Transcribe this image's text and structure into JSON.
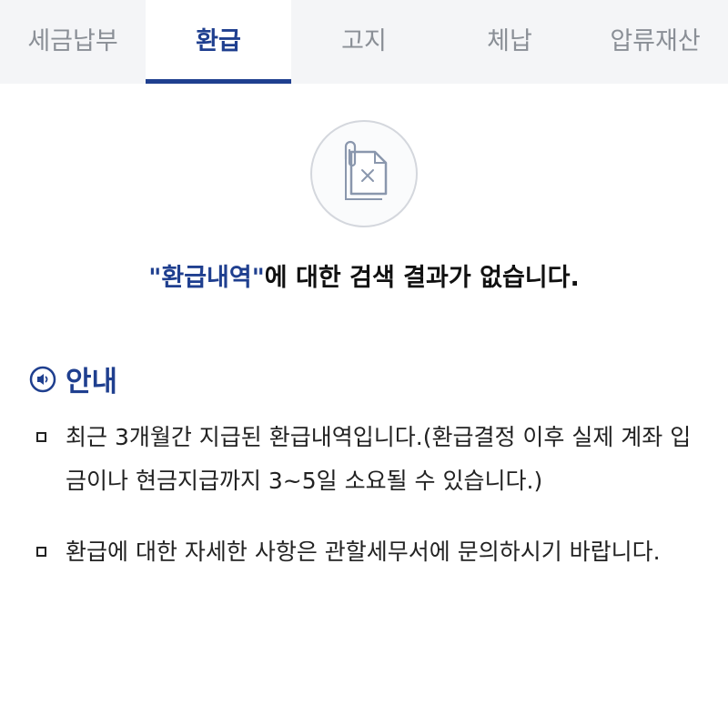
{
  "tabs": [
    {
      "label": "세금납부",
      "active": false
    },
    {
      "label": "환급",
      "active": true
    },
    {
      "label": "고지",
      "active": false
    },
    {
      "label": "체납",
      "active": false
    },
    {
      "label": "압류재산",
      "active": false
    }
  ],
  "empty_state": {
    "icon": "paper-clip-document-x-icon",
    "keyword": "\"환급내역\"",
    "message": "에 대한 검색 결과가 없습니다."
  },
  "notice": {
    "icon": "speaker-icon",
    "title": "안내",
    "items": [
      "최근 3개월간 지급된 환급내역입니다.(환급결정 이후 실제 계좌 입금이나 현금지급까지 3~5일 소요될 수 있습니다.)",
      "환급에 대한 자세한 사항은 관할세무서에 문의하시기 바랍니다."
    ]
  },
  "colors": {
    "accent": "#1f3f8f",
    "tab_background": "#f4f5f7",
    "inactive_tab_text": "#8a8f96"
  }
}
